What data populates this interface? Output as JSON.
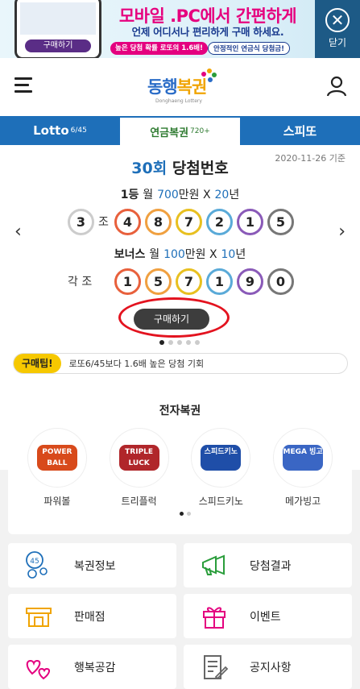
{
  "ad": {
    "title": "모바일 .PC에서 간편하게",
    "subtitle": "언제 어디서나 편리하게 구매 하세요.",
    "chip_left": "높은 당첨 확률 로또의 1.6배!",
    "chip_right": "안정적인 연금식 당첨금!",
    "phone_button": "구매하기",
    "close_label": "닫기"
  },
  "header": {
    "logo_main": "동행",
    "logo_accent": "복권",
    "logo_tag": "Donghaeng Lottery"
  },
  "tabs": [
    {
      "label": "Lotto",
      "sub": "6/45"
    },
    {
      "label": "연금복권",
      "sub": "720+"
    },
    {
      "label": "스피또",
      "sub": ""
    }
  ],
  "panel": {
    "date": "2020-11-26 기준",
    "round_num": "30회",
    "round_label": "당첨번호",
    "first_prize": {
      "rank": "1등",
      "monthly": "월",
      "amount": "700",
      "unit": "만원 X",
      "years": "20",
      "years_unit": "년"
    },
    "first_group": "3",
    "first_group_suffix": "조",
    "first_numbers": [
      "4",
      "8",
      "7",
      "2",
      "1",
      "5"
    ],
    "bonus_prize": {
      "rank": "보너스",
      "monthly": "월",
      "amount": "100",
      "unit": "만원 X",
      "years": "10",
      "years_unit": "년"
    },
    "bonus_group": "각 조",
    "bonus_numbers": [
      "1",
      "5",
      "7",
      "1",
      "9",
      "0"
    ],
    "buy_label": "구매하기",
    "tip_label": "구매팁!",
    "tip_text": "로또6/45보다 1.6배 높은 당첨 기회"
  },
  "ball_colors": [
    "#e8603c",
    "#f0a040",
    "#e8c020",
    "#5aaad8",
    "#8a5ab8",
    "#777777"
  ],
  "elottery": {
    "title": "전자복권",
    "games": [
      {
        "name": "파워볼",
        "badge": "POWER BALL",
        "color": "#d84a1b"
      },
      {
        "name": "트리플럭",
        "badge": "TRIPLE LUCK",
        "color": "#b0262a"
      },
      {
        "name": "스피드키노",
        "badge": "스피드키노",
        "color": "#1f4ea8"
      },
      {
        "name": "메가빙고",
        "badge": "MEGA 빙고",
        "color": "#3a66c4"
      }
    ]
  },
  "menu": [
    {
      "label": "복권정보",
      "icon": "lottery-info-icon"
    },
    {
      "label": "당첨결과",
      "icon": "megaphone-icon"
    },
    {
      "label": "판매점",
      "icon": "store-icon"
    },
    {
      "label": "이벤트",
      "icon": "gift-icon"
    },
    {
      "label": "행복공감",
      "icon": "hearts-icon"
    },
    {
      "label": "공지사항",
      "icon": "notice-icon"
    }
  ]
}
